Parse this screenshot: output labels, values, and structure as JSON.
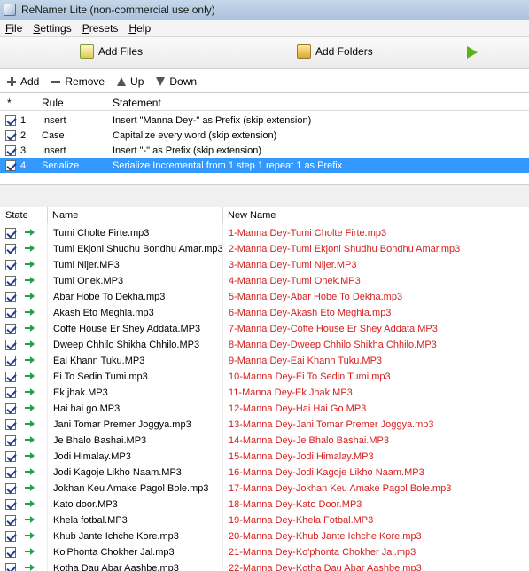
{
  "window": {
    "title": "ReNamer Lite (non-commercial use only)"
  },
  "menu": [
    "File",
    "Settings",
    "Presets",
    "Help"
  ],
  "toolbar": {
    "add_files": "Add Files",
    "add_folders": "Add Folders"
  },
  "rule_toolbar": {
    "add": "Add",
    "remove": "Remove",
    "up": "Up",
    "down": "Down"
  },
  "rules": {
    "headers": {
      "sort": "*",
      "rule": "Rule",
      "statement": "Statement"
    },
    "rows": [
      {
        "num": "1",
        "rule": "Insert",
        "statement": "Insert \"Manna Dey-\" as Prefix (skip extension)"
      },
      {
        "num": "2",
        "rule": "Case",
        "statement": "Capitalize every word (skip extension)"
      },
      {
        "num": "3",
        "rule": "Insert",
        "statement": "Insert \"-\" as Prefix (skip extension)"
      },
      {
        "num": "4",
        "rule": "Serialize",
        "statement": "Serialize Incremental from 1 step 1 repeat 1 as Prefix"
      }
    ]
  },
  "files": {
    "headers": {
      "state": "State",
      "name": "Name",
      "new_name": "New Name"
    },
    "rows": [
      {
        "name": "Tumi Cholte Firte.mp3",
        "new_name": "1-Manna Dey-Tumi Cholte Firte.mp3"
      },
      {
        "name": "Tumi Ekjoni Shudhu Bondhu Amar.mp3",
        "new_name": "2-Manna Dey-Tumi Ekjoni Shudhu Bondhu Amar.mp3"
      },
      {
        "name": "Tumi Nijer.MP3",
        "new_name": "3-Manna Dey-Tumi Nijer.MP3"
      },
      {
        "name": "Tumi Onek.MP3",
        "new_name": "4-Manna Dey-Tumi Onek.MP3"
      },
      {
        "name": "Abar Hobe To Dekha.mp3",
        "new_name": "5-Manna Dey-Abar Hobe To Dekha.mp3"
      },
      {
        "name": "Akash Eto Meghla.mp3",
        "new_name": "6-Manna Dey-Akash Eto Meghla.mp3"
      },
      {
        "name": "Coffe House Er Shey Addata.MP3",
        "new_name": "7-Manna Dey-Coffe House Er Shey Addata.MP3"
      },
      {
        "name": "Dweep Chhilo Shikha Chhilo.MP3",
        "new_name": "8-Manna Dey-Dweep Chhilo Shikha Chhilo.MP3"
      },
      {
        "name": "Eai Khann Tuku.MP3",
        "new_name": "9-Manna Dey-Eai Khann Tuku.MP3"
      },
      {
        "name": "Ei To Sedin Tumi.mp3",
        "new_name": "10-Manna Dey-Ei To Sedin Tumi.mp3"
      },
      {
        "name": "Ek jhak.MP3",
        "new_name": "11-Manna Dey-Ek Jhak.MP3"
      },
      {
        "name": "Hai hai go.MP3",
        "new_name": "12-Manna Dey-Hai Hai Go.MP3"
      },
      {
        "name": "Jani Tomar Premer Joggya.mp3",
        "new_name": "13-Manna Dey-Jani Tomar Premer Joggya.mp3"
      },
      {
        "name": "Je Bhalo Bashai.MP3",
        "new_name": "14-Manna Dey-Je Bhalo Bashai.MP3"
      },
      {
        "name": "Jodi Himalay.MP3",
        "new_name": "15-Manna Dey-Jodi Himalay.MP3"
      },
      {
        "name": "Jodi Kagoje Likho Naam.MP3",
        "new_name": "16-Manna Dey-Jodi Kagoje Likho Naam.MP3"
      },
      {
        "name": "Jokhan Keu Amake Pagol Bole.mp3",
        "new_name": "17-Manna Dey-Jokhan Keu Amake Pagol Bole.mp3"
      },
      {
        "name": "Kato door.MP3",
        "new_name": "18-Manna Dey-Kato Door.MP3"
      },
      {
        "name": "Khela fotbal.MP3",
        "new_name": "19-Manna Dey-Khela Fotbal.MP3"
      },
      {
        "name": "Khub Jante Ichche Kore.mp3",
        "new_name": "20-Manna Dey-Khub Jante Ichche Kore.mp3"
      },
      {
        "name": "Ko'Phonta Chokher Jal.mp3",
        "new_name": "21-Manna Dey-Ko'phonta Chokher Jal.mp3"
      },
      {
        "name": "Kotha Dau Abar Aashbe.mp3",
        "new_name": "22-Manna Dey-Kotha Dau Abar Aashbe.mp3"
      }
    ]
  }
}
